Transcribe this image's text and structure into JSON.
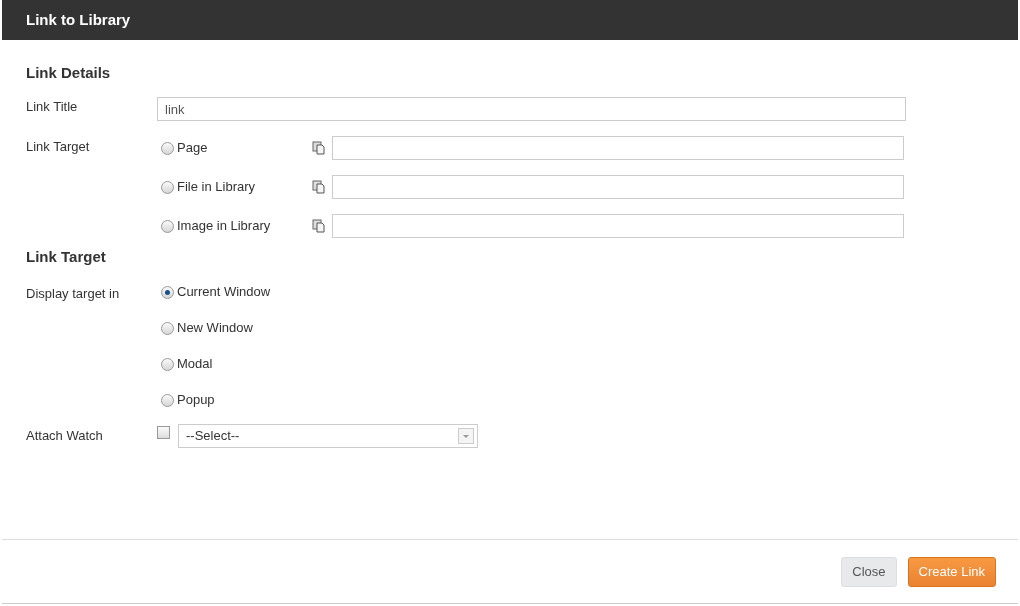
{
  "dialog": {
    "title": "Link to Library"
  },
  "link_details": {
    "heading": "Link Details",
    "title_label": "Link Title",
    "title_value": "link",
    "target_label": "Link Target",
    "targets": [
      {
        "label": "Page",
        "selected": false
      },
      {
        "label": "File in Library",
        "selected": false
      },
      {
        "label": "Image in Library",
        "selected": false
      }
    ]
  },
  "link_target": {
    "heading": "Link Target",
    "display_label": "Display target in",
    "options": [
      {
        "label": "Current Window",
        "selected": true
      },
      {
        "label": "New Window",
        "selected": false
      },
      {
        "label": "Modal",
        "selected": false
      },
      {
        "label": "Popup",
        "selected": false
      }
    ],
    "watch_label": "Attach Watch",
    "watch_checked": false,
    "watch_select": "--Select--"
  },
  "buttons": [
    {
      "label": "Close",
      "kind": "secondary"
    },
    {
      "label": "Create Link",
      "kind": "primary"
    }
  ]
}
